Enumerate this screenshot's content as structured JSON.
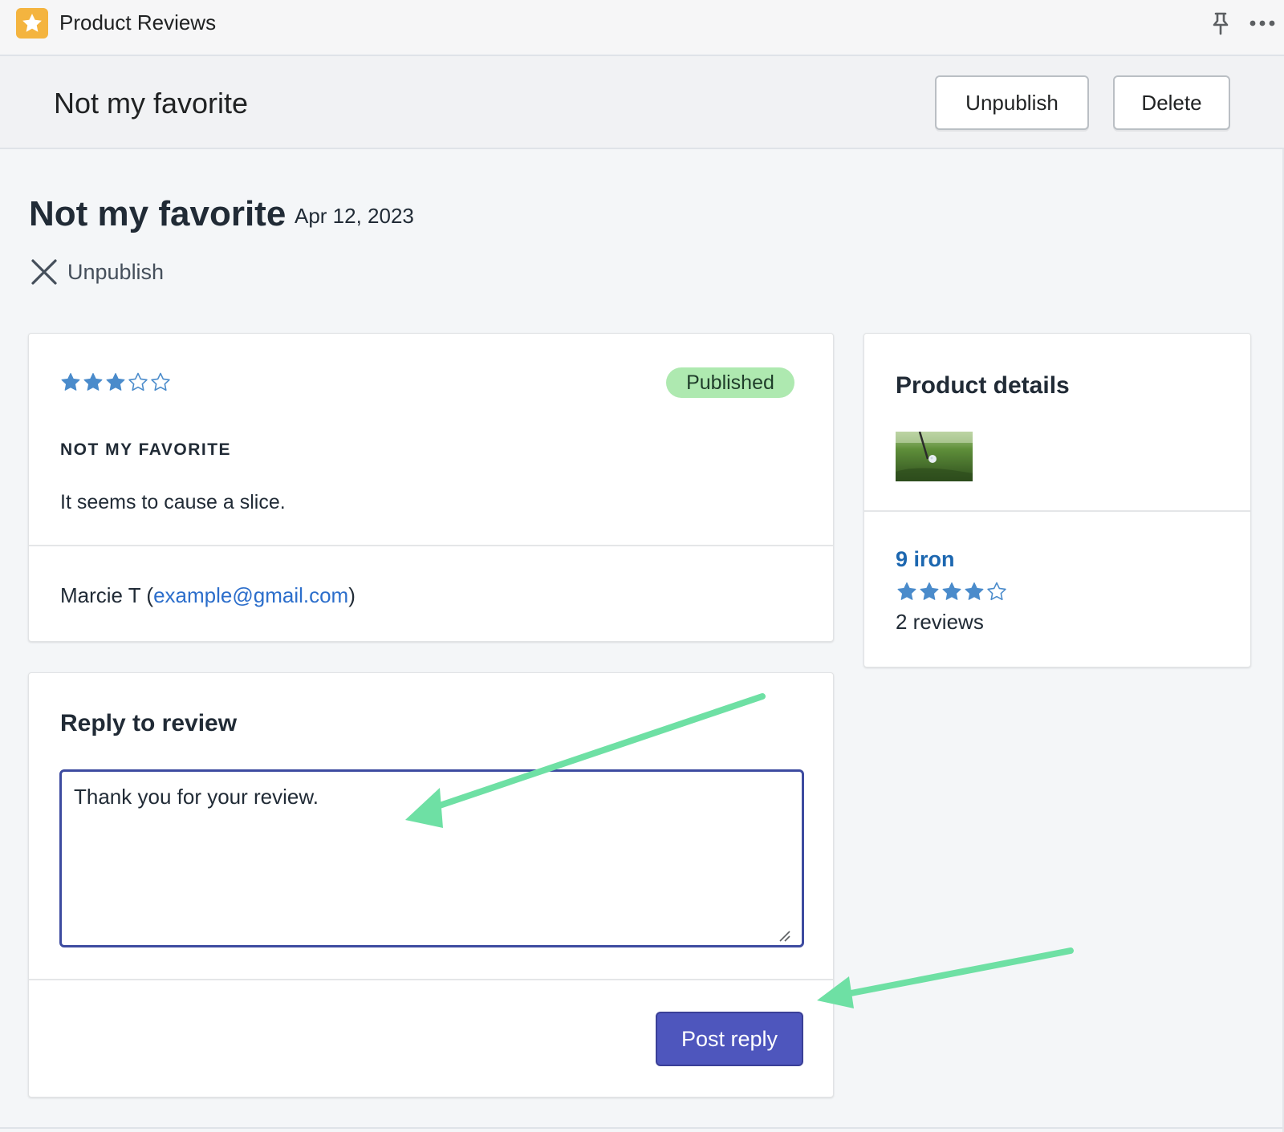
{
  "app": {
    "title": "Product Reviews",
    "logo_icon": "star-icon",
    "actions": [
      "pin-icon",
      "more-icon"
    ]
  },
  "titlebar": {
    "title": "Not my favorite",
    "unpublish_label": "Unpublish",
    "delete_label": "Delete"
  },
  "page": {
    "heading": "Not my favorite",
    "date": "Apr 12, 2023",
    "unpublish_link": "Unpublish"
  },
  "review": {
    "rating": 3,
    "max_rating": 5,
    "status": "Published",
    "title": "NOT MY FAVORITE",
    "body": "It seems to cause a slice.",
    "author_name": "Marcie T",
    "author_prefix": " (",
    "author_email": "example@gmail.com",
    "author_suffix": ")"
  },
  "product": {
    "heading": "Product details",
    "name": "9 iron",
    "rating": 4,
    "max_rating": 5,
    "reviews": "2 reviews"
  },
  "reply": {
    "heading": "Reply to review",
    "text": "Thank you for your review.",
    "button_label": "Post reply"
  },
  "colors": {
    "accent": "#4e56bd",
    "star": "#4a8bcb",
    "badge_bg": "#aee9b0",
    "link": "#2c6ecb",
    "arrow": "#6ee0a4",
    "logo": "#f4b43f"
  }
}
